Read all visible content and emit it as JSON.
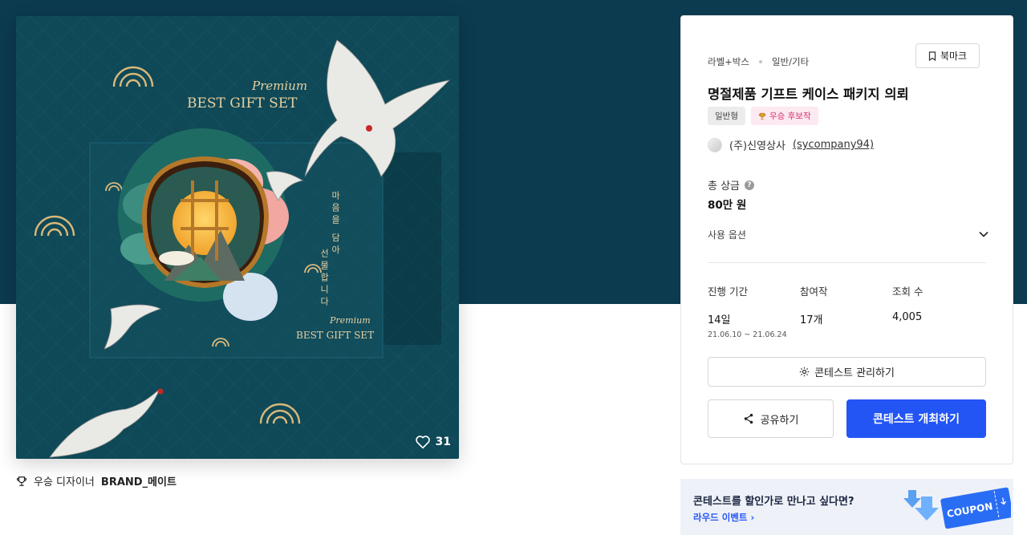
{
  "artwork": {
    "like_count": "31",
    "winner_prefix": "우승 디자이너",
    "winner_name": "BRAND_메이트",
    "gift_word_top": "Premium",
    "gift_title_top": "BEST GIFT SET",
    "gift_word_box": "Premium",
    "gift_title_box": "BEST GIFT SET",
    "vertical_line_1": "마음을 담아",
    "vertical_line_2": "선물합니다"
  },
  "contest": {
    "category_main": "라벨+박스",
    "category_sub": "일반/기타",
    "bookmark_label": "북마크",
    "title": "명절제품 기프트 케이스 패키지 의뢰",
    "badge_type": "일반형",
    "badge_status": "우승 후보작",
    "company_name": "(주)신영상사",
    "company_handle": "(sycompany94)",
    "prize_label": "총 상금",
    "prize_value": "80만 원",
    "options_label": "사용 옵션",
    "stats": {
      "period_label": "진행 기간",
      "period_value": "14일",
      "period_dates": "21.06.10 ~ 21.06.24",
      "entries_label": "참여작",
      "entries_value": "17개",
      "views_label": "조회 수",
      "views_value": "4,005"
    },
    "manage_label": "콘테스트 관리하기",
    "share_label": "공유하기",
    "host_label": "콘테스트 개최하기"
  },
  "promo": {
    "headline": "콘테스트를 할인가로 만나고 싶다면?",
    "link_label": "라우드 이벤트",
    "coupon_text": "COUPON"
  },
  "colors": {
    "hero_bg": "#0c3a4f",
    "artwork_bg": "#0f4856",
    "primary": "#2355f5",
    "badge_pink": "#d6336c",
    "gold": "#d9b97a"
  }
}
